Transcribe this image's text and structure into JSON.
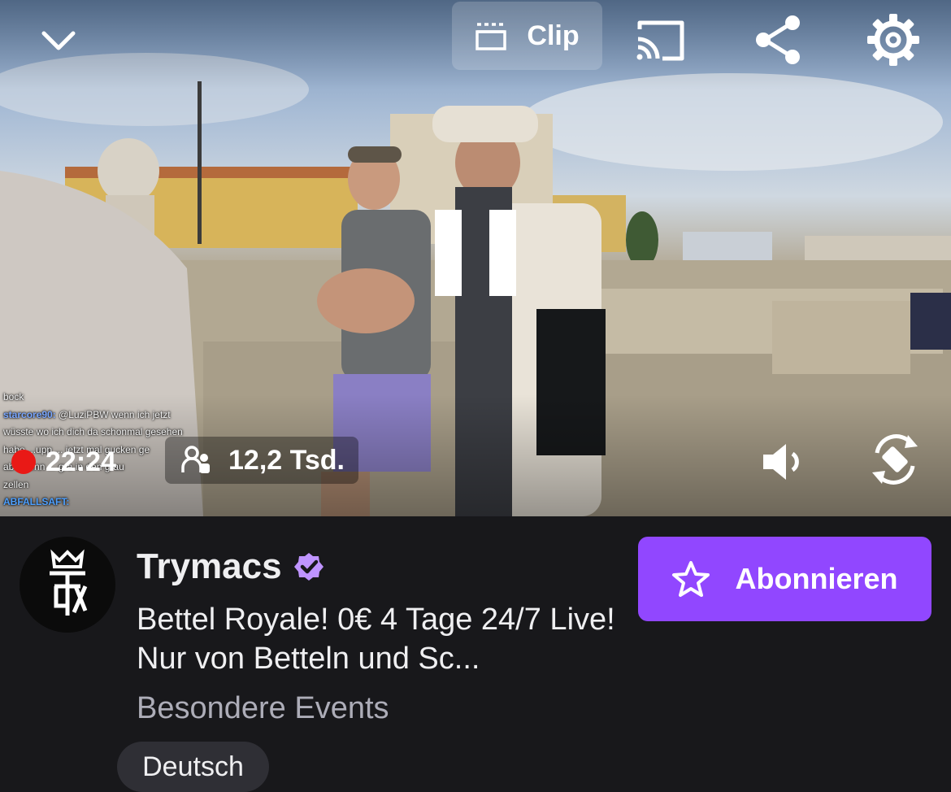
{
  "player": {
    "clip_label": "Clip",
    "live_time": "22:24",
    "viewer_count": "12,2 Tsd.",
    "chat_overlay": [
      {
        "user": "",
        "text": "bock"
      },
      {
        "user": "starcore90:",
        "text": " @LuziPBW wenn ich jetzt"
      },
      {
        "user": "",
        "text": "wüsste wo ich dich da schonmal gesehen"
      },
      {
        "user": "",
        "text": "habe ...upp ... jetzt mal gucken ge"
      },
      {
        "user": "",
        "text": "aber renn ... gra in den grau"
      },
      {
        "user": "",
        "text": "zellen"
      },
      {
        "user": "ABFALLSAFT:",
        "text": ""
      }
    ],
    "icons": {
      "minimize": "chevron-down-icon",
      "clip": "clapperboard-icon",
      "cast": "cast-icon",
      "share": "share-icon",
      "settings": "gear-icon",
      "pause": "pause-icon",
      "viewers": "viewers-icon",
      "volume": "volume-icon",
      "rotate": "rotate-screen-icon"
    }
  },
  "channel": {
    "name": "Trymacs",
    "verified": true,
    "title": "Bettel Royale! 0€ 4 Tage 24/7 Live! Nur von Betteln und Sc...",
    "category": "Besondere Events",
    "tags": [
      "Deutsch"
    ],
    "subscribe_label": "Abonnieren"
  },
  "colors": {
    "accent": "#9147ff",
    "background": "#18181b",
    "live": "#e91916",
    "verified": "#bf94ff",
    "muted_text": "#adadb8"
  }
}
